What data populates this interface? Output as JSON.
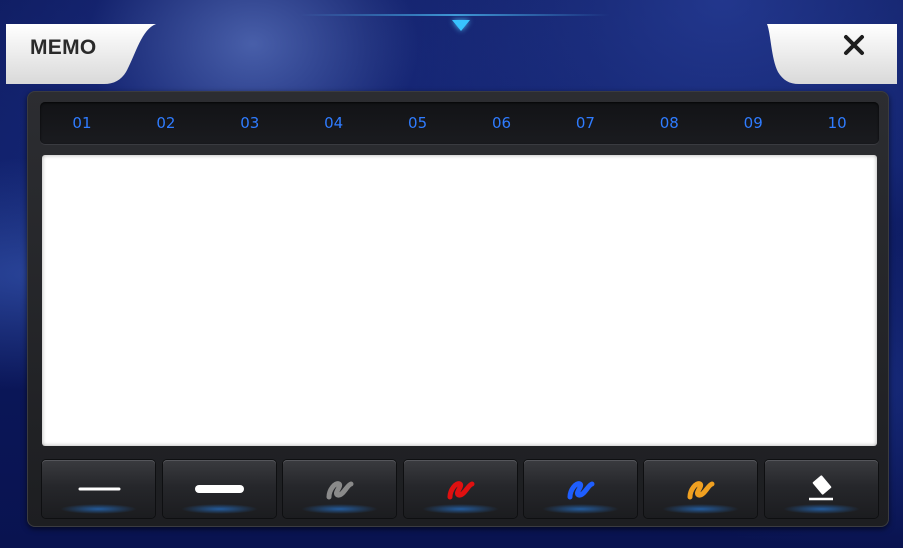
{
  "app": {
    "title": "MEMO",
    "close_icon": "close-icon"
  },
  "pages": [
    "01",
    "02",
    "03",
    "04",
    "05",
    "06",
    "07",
    "08",
    "09",
    "10"
  ],
  "tools": [
    {
      "name": "thin-line-tool",
      "icon": "thin-line-icon",
      "color": "#ffffff"
    },
    {
      "name": "thick-line-tool",
      "icon": "thick-line-icon",
      "color": "#ffffff"
    },
    {
      "name": "gray-pen-tool",
      "icon": "pen-stroke-icon",
      "color": "#8a8a8a"
    },
    {
      "name": "red-pen-tool",
      "icon": "pen-stroke-icon",
      "color": "#e01010"
    },
    {
      "name": "blue-pen-tool",
      "icon": "pen-stroke-icon",
      "color": "#1e5eff"
    },
    {
      "name": "orange-pen-tool",
      "icon": "pen-stroke-icon",
      "color": "#f0a020"
    },
    {
      "name": "eraser-tool",
      "icon": "eraser-icon",
      "color": "#ffffff"
    }
  ],
  "colors": {
    "accent": "#2f7cff",
    "indicator": "#38c3ff"
  }
}
